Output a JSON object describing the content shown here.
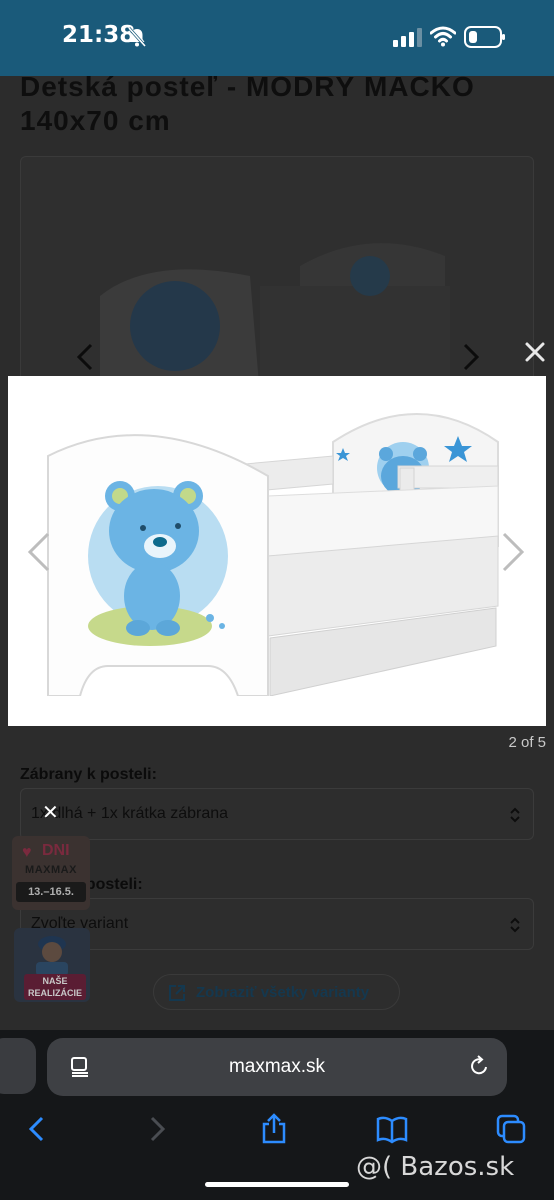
{
  "status_bar": {
    "time": "21:38",
    "icons": [
      "bell-slash-icon",
      "signal-icon",
      "wifi-icon",
      "battery-icon"
    ]
  },
  "page": {
    "title": "Detská posteľ - MODRÝ MACKO 140x70 cm",
    "gallery_counter": "2 of 5",
    "fields": [
      {
        "label": "Zábrany k posteli:",
        "value": "1x dlhá + 1x krátka zábrana"
      },
      {
        "label": "Šuplík k posteli:",
        "value": "Zvoľte variant"
      }
    ],
    "variants_button": "Zobraziť všetky varianty"
  },
  "promos": {
    "dni": "DNI",
    "brand": "MAXMAX",
    "dates": "13.–16.5.",
    "realizacie": "NAŠE REALIZÁCIE",
    "close": "✕"
  },
  "modal": {
    "close_icon": "close-icon",
    "image_alt": "Detská posteľ s modrým mackom"
  },
  "browser": {
    "url": "maxmax.sk",
    "toolbar_icons": [
      "back-icon",
      "forward-icon",
      "share-icon",
      "bookmarks-icon",
      "tabs-icon"
    ]
  },
  "watermark": "@( Bazos.sk",
  "colors": {
    "status_bar": "#1a5a7a",
    "overlay": "#1d2023",
    "link_blue": "#14384f",
    "ios_blue": "#2d8cff"
  }
}
